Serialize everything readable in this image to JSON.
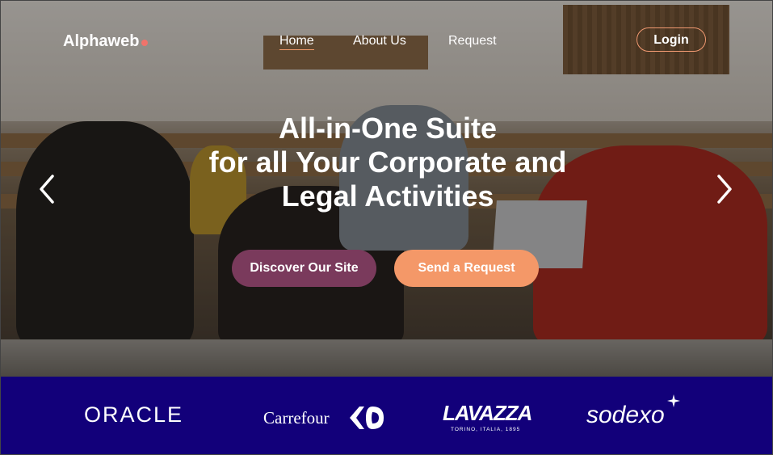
{
  "header": {
    "brand": "Alphaweb",
    "nav": [
      "Home",
      "About Us",
      "Request"
    ],
    "login_label": "Login"
  },
  "hero": {
    "headline_line1": "All-in-One Suite",
    "headline_line2": "for all Your Corporate and",
    "headline_line3": "Legal Activities",
    "discover_label": "Discover Our Site",
    "request_label": "Send a Request"
  },
  "partners": {
    "oracle": "ORACLE",
    "carrefour": "Carrefour",
    "lavazza": "LAVAZZA",
    "lavazza_tagline": "TORINO, ITALIA, 1895",
    "sodexo": "sodexo"
  },
  "colors": {
    "accent": "#f49868",
    "primary_button": "#7a3a5c",
    "partners_band": "#12007a",
    "logo_dot": "#f0736b"
  },
  "icons": {
    "prev": "chevron-left-icon",
    "next": "chevron-right-icon"
  }
}
